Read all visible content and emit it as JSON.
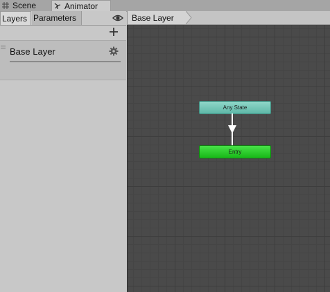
{
  "tabs": {
    "scene_label": "Scene",
    "animator_label": "Animator"
  },
  "left_panel": {
    "layers_tab": "Layers",
    "parameters_tab": "Parameters",
    "layer": {
      "name": "Base Layer"
    }
  },
  "graph": {
    "breadcrumb": "Base Layer",
    "states": {
      "any_state": "Any State",
      "entry": "Entry"
    }
  },
  "colors": {
    "any_state": "#6fc4b5",
    "entry": "#2fcc2f",
    "graph_bg": "#4a4a4a"
  }
}
